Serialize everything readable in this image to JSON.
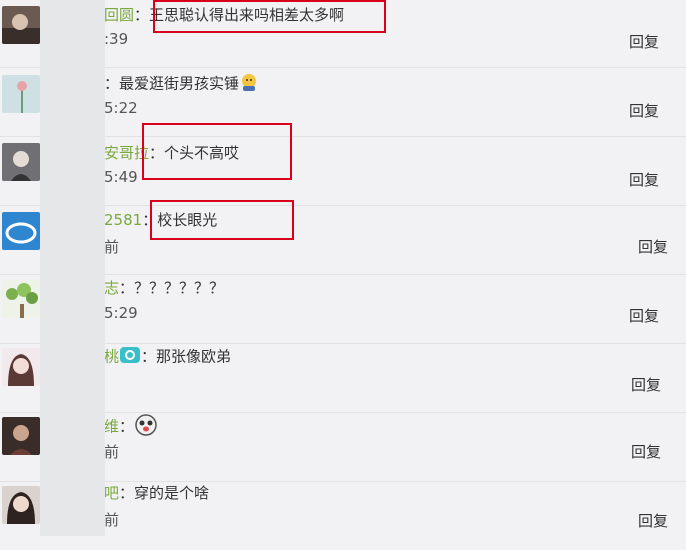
{
  "comments": [
    {
      "name": "回圆",
      "text": "：王思聪认得出来吗相差太多啊",
      "time": ":39",
      "reply": "回复"
    },
    {
      "name": "",
      "text": "：最爱逛街男孩实锤",
      "emoji": "thinking-face-icon",
      "time": "5:22",
      "reply": "回复"
    },
    {
      "name": "安哥拉",
      "text": "：个头不高哎",
      "time": "5:49",
      "reply": "回复"
    },
    {
      "name": "2581",
      "text": "：校长眼光",
      "time": "前",
      "reply": "回复"
    },
    {
      "name": "志",
      "text": "：？？？？？？",
      "time": "5:29",
      "reply": "回复"
    },
    {
      "name": "桃",
      "text": "：那张像欧弟",
      "badge": "camera-badge-icon",
      "time": "",
      "reply": "回复"
    },
    {
      "name": "维",
      "text": "：",
      "emoji": "funny-face-icon",
      "time": "前",
      "reply": "回复"
    },
    {
      "name": "吧",
      "text": "：穿的是个啥",
      "time": "前",
      "reply": "回复"
    }
  ],
  "colors": {
    "name": "#7aa83f",
    "highlight": "#d9001b",
    "background": "#f2f2f5"
  }
}
